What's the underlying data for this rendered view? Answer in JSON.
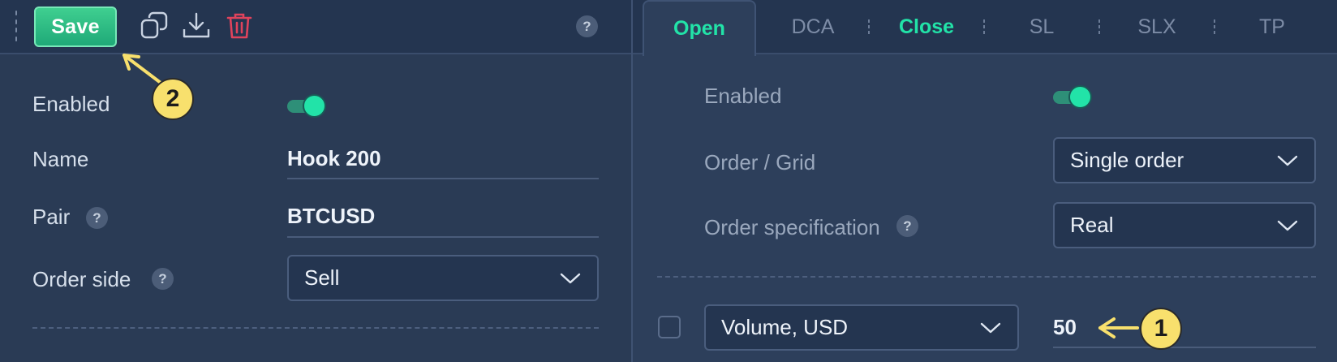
{
  "toolbar": {
    "save_label": "Save",
    "help_glyph": "?",
    "icons": [
      "drag-handle-icon",
      "copy-icon",
      "download-icon",
      "trash-icon",
      "help-icon"
    ]
  },
  "left_form": {
    "enabled_label": "Enabled",
    "enabled_value": true,
    "name_label": "Name",
    "name_value": "Hook 200",
    "pair_label": "Pair",
    "pair_value": "BTCUSD",
    "order_side_label": "Order side",
    "order_side_value": "Sell",
    "help_glyph": "?"
  },
  "tabs": [
    {
      "label": "Open",
      "active": true
    },
    {
      "label": "DCA",
      "active": false
    },
    {
      "label": "Close",
      "active": false,
      "highlighted": true
    },
    {
      "label": "SL",
      "active": false
    },
    {
      "label": "SLX",
      "active": false
    },
    {
      "label": "TP",
      "active": false
    }
  ],
  "right_form": {
    "enabled_label": "Enabled",
    "enabled_value": true,
    "order_grid_label": "Order / Grid",
    "order_grid_value": "Single order",
    "order_spec_label": "Order specification",
    "order_spec_value": "Real",
    "volume_type_value": "Volume, USD",
    "volume_value": "50",
    "help_glyph": "?"
  },
  "annotations": {
    "badge_1": "1",
    "badge_2": "2"
  },
  "colors": {
    "accent": "#22e3a8",
    "save_button": "#2fbf85",
    "delete_icon": "#e0435c",
    "annotation": "#f8e06d",
    "background": "#2a3b55"
  }
}
